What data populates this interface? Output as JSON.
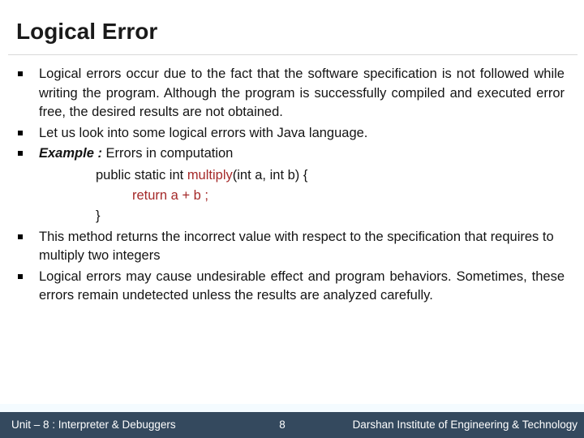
{
  "slide": {
    "title": "Logical Error",
    "colors": {
      "footer_bg": "#34495E",
      "footer_text": "#FFFFFF",
      "code_accent": "#A52A2A",
      "title_text": "#1A1A1A",
      "rule": "#D9D9D9"
    },
    "bullets": [
      {
        "text": "Logical errors occur due to the fact that the software specification is not followed while writing the program. Although the program is successfully compiled and executed error free, the desired results are not obtained."
      },
      {
        "text": "Let us look into some logical errors with Java language."
      },
      {
        "lead": "Example :",
        "text": " Errors in computation"
      },
      {
        "text": "This method returns the incorrect value with respect to the specification that requires to multiply two integers"
      },
      {
        "text": "Logical errors may cause undesirable effect and program behaviors. Sometimes, these errors remain undetected unless the results are analyzed carefully."
      }
    ],
    "code": {
      "line1_before": "public static int ",
      "line1_method": "multiply",
      "line1_after": "(int a, int b) {",
      "line2": "return a + b ;",
      "line3": "}"
    }
  },
  "footer": {
    "left": "Unit – 8 : Interpreter & Debuggers",
    "page": "8",
    "right": "Darshan Institute of Engineering & Technology"
  }
}
